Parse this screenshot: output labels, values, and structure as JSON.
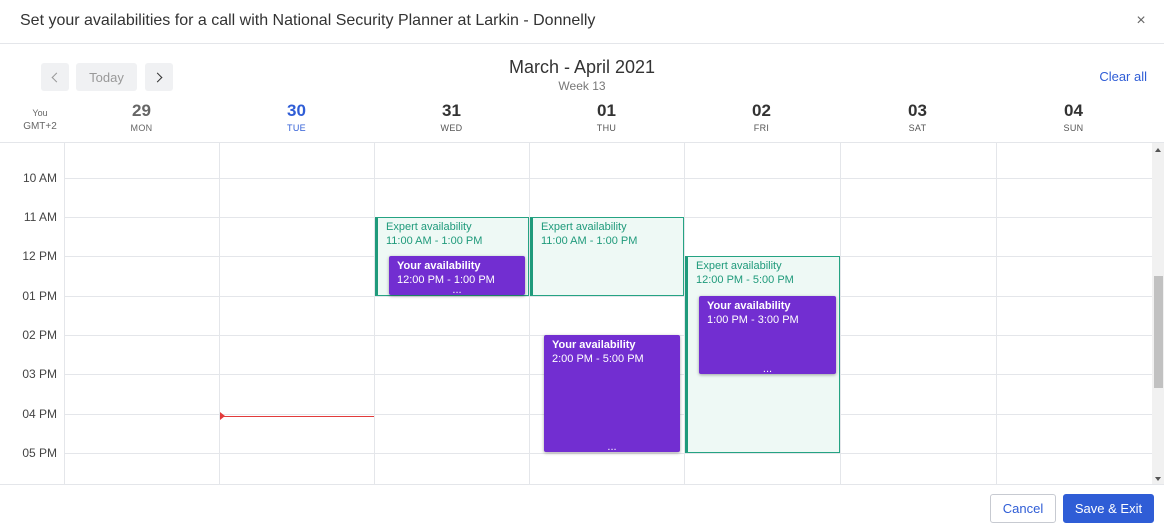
{
  "modal": {
    "title": "Set your availabilities for a call with National Security Planner at Larkin - Donnelly",
    "close_glyph": "×"
  },
  "nav": {
    "today_label": "Today",
    "period_title": "March - April 2021",
    "week_label": "Week 13",
    "clear_all_label": "Clear all"
  },
  "timezone": {
    "you_label": "You",
    "offset_label": "GMT+2"
  },
  "days": [
    {
      "num": "29",
      "name": "MON"
    },
    {
      "num": "30",
      "name": "TUE"
    },
    {
      "num": "31",
      "name": "WED"
    },
    {
      "num": "01",
      "name": "THU"
    },
    {
      "num": "02",
      "name": "FRI"
    },
    {
      "num": "03",
      "name": "SAT"
    },
    {
      "num": "04",
      "name": "SUN"
    }
  ],
  "hours": [
    "10 AM",
    "11 AM",
    "12 PM",
    "01 PM",
    "02 PM",
    "03 PM",
    "04 PM",
    "05 PM"
  ],
  "events": {
    "expert_wed": {
      "title": "Expert availability",
      "time": "11:00 AM - 1:00 PM"
    },
    "expert_thu": {
      "title": "Expert availability",
      "time": "11:00 AM - 1:00 PM"
    },
    "expert_fri": {
      "title": "Expert availability",
      "time": "12:00 PM - 5:00 PM"
    },
    "yours_wed": {
      "title": "Your availability",
      "time": "12:00 PM - 1:00 PM",
      "more": "..."
    },
    "yours_thu": {
      "title": "Your availability",
      "time": "2:00 PM - 5:00 PM",
      "more": "..."
    },
    "yours_fri": {
      "title": "Your availability",
      "time": "1:00 PM - 3:00 PM",
      "more": "..."
    }
  },
  "footer": {
    "cancel_label": "Cancel",
    "save_label": "Save & Exit"
  },
  "colors": {
    "accent": "#2f5dd6",
    "expert": "#1f9a7b",
    "yours": "#722ed1",
    "now_line": "#e23b3b"
  }
}
